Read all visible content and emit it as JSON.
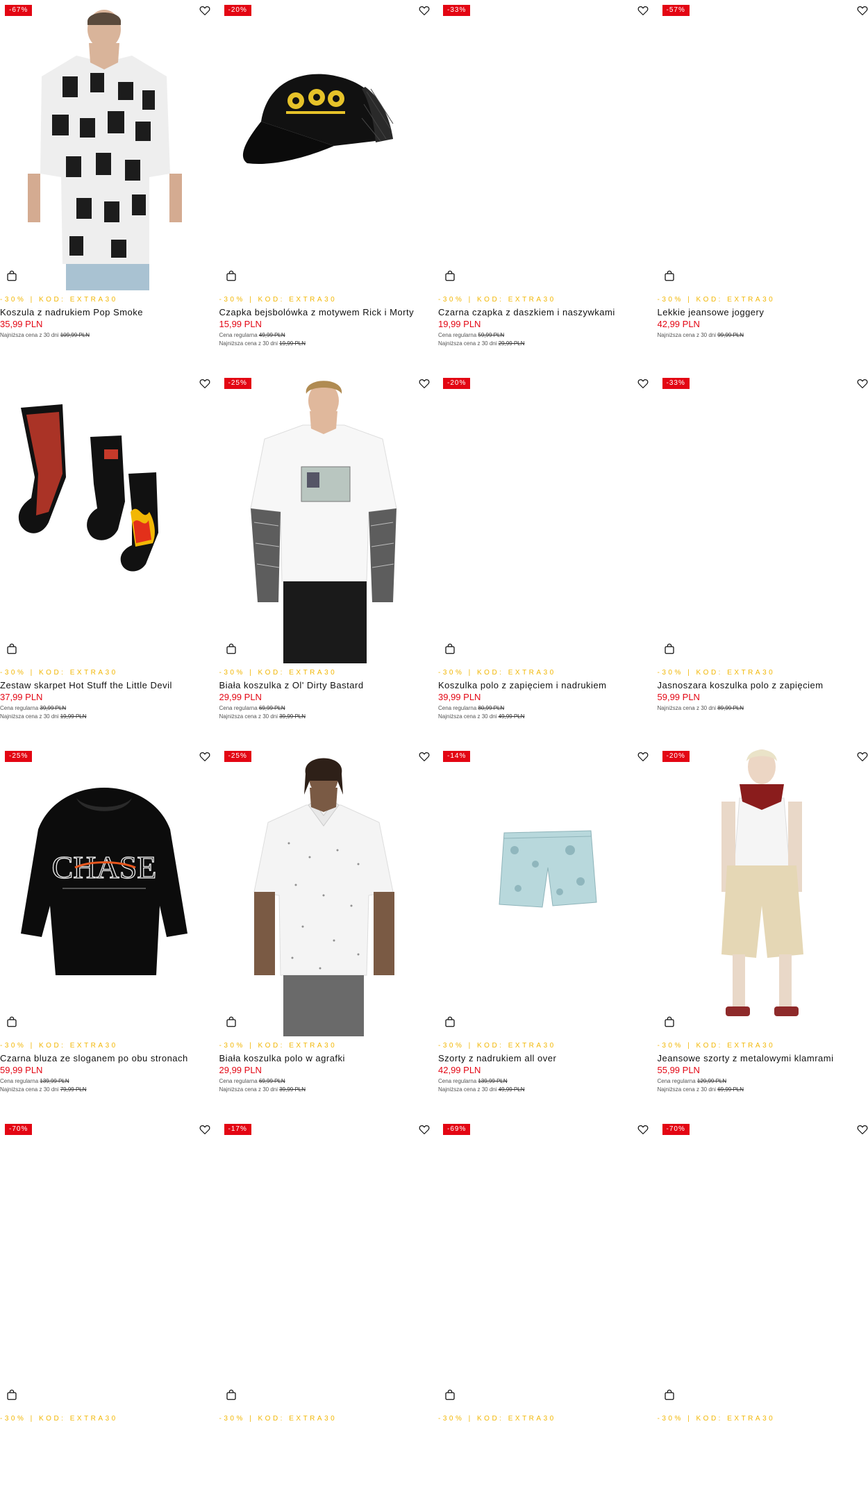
{
  "promo_text": "-30% | KOD: EXTRA30",
  "labels": {
    "regular": "Cena regularna",
    "lowest30": "Najniższa cena z 30 dni"
  },
  "colors": {
    "sale_red": "#e30613",
    "promo_yellow": "#f2b705"
  },
  "icons": {
    "wishlist": "heart-outline-icon",
    "cart": "shopping-bag-icon"
  },
  "products": [
    {
      "badge": "-67%",
      "name": "Koszula z nadrukiem Pop Smoke",
      "price": "35,99 PLN",
      "regular": "",
      "lowest": "109,99 PLN",
      "image": "shirt-print"
    },
    {
      "badge": "-20%",
      "name": "Czapka bejsbolówka z motywem Rick i Morty",
      "price": "15,99 PLN",
      "regular": "49,99 PLN",
      "lowest": "19,99 PLN",
      "image": "cap"
    },
    {
      "badge": "-33%",
      "name": "Czarna czapka z daszkiem i naszywkami",
      "price": "19,99 PLN",
      "regular": "59,99 PLN",
      "lowest": "29,99 PLN",
      "image": "blank"
    },
    {
      "badge": "-57%",
      "name": "Lekkie jeansowe joggery",
      "price": "42,99 PLN",
      "regular": "",
      "lowest": "99,99 PLN",
      "image": "blank"
    },
    {
      "badge": "",
      "name": "Zestaw skarpet Hot Stuff the Little Devil",
      "price": "37,99 PLN",
      "regular": "39,99 PLN",
      "lowest": "19,99 PLN",
      "image": "socks"
    },
    {
      "badge": "-25%",
      "name": "Biała koszulka z Ol' Dirty Bastard",
      "price": "29,99 PLN",
      "regular": "69,99 PLN",
      "lowest": "39,99 PLN",
      "image": "tshirt-man"
    },
    {
      "badge": "-20%",
      "name": "Koszulka polo z zapięciem i nadrukiem",
      "price": "39,99 PLN",
      "regular": "80,99 PLN",
      "lowest": "49,99 PLN",
      "image": "blank"
    },
    {
      "badge": "-33%",
      "name": "Jasnoszara koszulka polo z zapięciem",
      "price": "59,99 PLN",
      "regular": "",
      "lowest": "89,99 PLN",
      "image": "blank"
    },
    {
      "badge": "-25%",
      "name": "Czarna bluza ze sloganem po obu stronach",
      "price": "59,99 PLN",
      "regular": "139,99 PLN",
      "lowest": "79,99 PLN",
      "image": "hoodie",
      "hoodie_text": "CHASE"
    },
    {
      "badge": "-25%",
      "name": "Biała koszulka polo w agrafki",
      "price": "29,99 PLN",
      "regular": "69,99 PLN",
      "lowest": "39,99 PLN",
      "image": "polo-man"
    },
    {
      "badge": "-14%",
      "name": "Szorty z nadrukiem all over",
      "price": "42,99 PLN",
      "regular": "139,99 PLN",
      "lowest": "49,99 PLN",
      "image": "shorts"
    },
    {
      "badge": "-20%",
      "name": "Jeansowe szorty z metalowymi klamrami",
      "price": "55,99 PLN",
      "regular": "129,99 PLN",
      "lowest": "69,99 PLN",
      "image": "shorts-man"
    },
    {
      "badge": "-70%",
      "name": "",
      "price": "",
      "regular": "",
      "lowest": "",
      "image": "blank"
    },
    {
      "badge": "-17%",
      "name": "",
      "price": "",
      "regular": "",
      "lowest": "",
      "image": "blank"
    },
    {
      "badge": "-69%",
      "name": "",
      "price": "",
      "regular": "",
      "lowest": "",
      "image": "blank"
    },
    {
      "badge": "-70%",
      "name": "",
      "price": "",
      "regular": "",
      "lowest": "",
      "image": "blank"
    }
  ]
}
